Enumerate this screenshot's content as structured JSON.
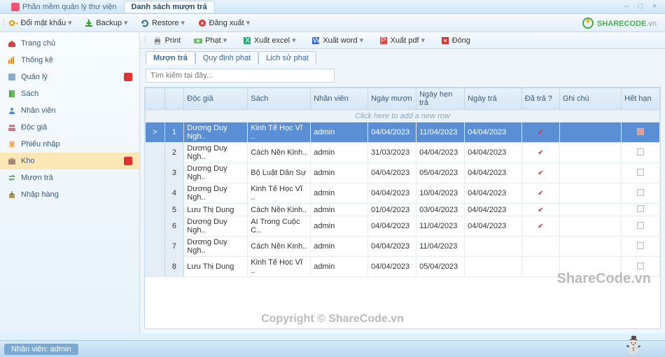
{
  "window": {
    "app_tab": "Phần mềm quản lý thư viện",
    "active_tab": "Danh sách mượn trả"
  },
  "toolbar1": {
    "change_pw": "Đổi mật khẩu",
    "backup": "Backup",
    "restore": "Restore",
    "logout": "Đăng xuất"
  },
  "sidebar": {
    "items": [
      {
        "label": "Trang chủ",
        "icon": "home",
        "badge": false
      },
      {
        "label": "Thống kê",
        "icon": "stats",
        "badge": false
      },
      {
        "label": "Quản lý",
        "icon": "manage",
        "badge": true
      },
      {
        "label": "Sách",
        "icon": "book",
        "badge": false
      },
      {
        "label": "Nhân viên",
        "icon": "user",
        "badge": false
      },
      {
        "label": "Độc giả",
        "icon": "users",
        "badge": false
      },
      {
        "label": "Phiếu nhập",
        "icon": "slip",
        "badge": false
      },
      {
        "label": "Kho",
        "icon": "store",
        "badge": true,
        "sel": true
      },
      {
        "label": "Mượn trả",
        "icon": "swap",
        "badge": false
      },
      {
        "label": "Nhập hàng",
        "icon": "import",
        "badge": false
      }
    ]
  },
  "toolbar2": {
    "print": "Print",
    "fine": "Phạt",
    "excel": "Xuất excel",
    "word": "Xuất word",
    "pdf": "Xuất pdf",
    "close": "Đóng"
  },
  "tabs2": {
    "t0": "Mượn trả",
    "t1": "Quy định phạt",
    "t2": "Lịch sử phạt"
  },
  "search": {
    "placeholder": "Tìm kiếm tại đây..."
  },
  "grid": {
    "cols": {
      "reader": "Độc giả",
      "book": "Sách",
      "staff": "Nhân viên",
      "borrow": "Ngày mượn",
      "due": "Ngày hẹn trả",
      "return": "Ngày trả",
      "returned": "Đã trả ?",
      "note": "Ghi chú",
      "expired": "Hết hạn"
    },
    "newrow": "Click here to add a new row",
    "rows": [
      {
        "n": "1",
        "reader": "Dương Duy Ngh..",
        "book": "Kinh Tế Học Vĩ ..",
        "staff": "admin",
        "borrow": "04/04/2023",
        "due": "11/04/2023",
        "return": "04/04/2023",
        "returned": true,
        "exp": true,
        "sel": true,
        "mark": ">"
      },
      {
        "n": "2",
        "reader": "Dương Duy Ngh..",
        "book": "Cách Nền Kinh..",
        "staff": "admin",
        "borrow": "31/03/2023",
        "due": "04/04/2023",
        "return": "04/04/2023",
        "returned": true,
        "exp": false
      },
      {
        "n": "3",
        "reader": "Dương Duy Ngh..",
        "book": "Bộ Luật Dân Sự",
        "staff": "admin",
        "borrow": "04/04/2023",
        "due": "05/04/2023",
        "return": "04/04/2023",
        "returned": true,
        "exp": false
      },
      {
        "n": "4",
        "reader": "Dương Duy Ngh..",
        "book": "Kinh Tế Học Vĩ ..",
        "staff": "admin",
        "borrow": "04/04/2023",
        "due": "10/04/2023",
        "return": "04/04/2023",
        "returned": true,
        "exp": false
      },
      {
        "n": "5",
        "reader": "Lưu Thị Dung",
        "book": "Cách Nền Kinh..",
        "staff": "admin",
        "borrow": "01/04/2023",
        "due": "03/04/2023",
        "return": "04/04/2023",
        "returned": true,
        "exp": false
      },
      {
        "n": "6",
        "reader": "Dương Duy Ngh..",
        "book": "AI Trong Cuộc C..",
        "staff": "admin",
        "borrow": "04/04/2023",
        "due": "11/04/2023",
        "return": "04/04/2023",
        "returned": true,
        "exp": false
      },
      {
        "n": "7",
        "reader": "Dương Duy Ngh..",
        "book": "Cách Nền Kinh..",
        "staff": "admin",
        "borrow": "04/04/2023",
        "due": "11/04/2023",
        "return": "",
        "returned": false,
        "exp": false
      },
      {
        "n": "8",
        "reader": "Lưu Thị Dung",
        "book": "Kinh Tế Học Vĩ ..",
        "staff": "admin",
        "borrow": "04/04/2023",
        "due": "05/04/2023",
        "return": "",
        "returned": false,
        "exp": false
      }
    ]
  },
  "status": {
    "user": "Nhân viên: admin"
  },
  "watermark": "ShareCode.vn",
  "copyright": "Copyright © ShareCode.vn",
  "logo": {
    "brand": "SHARECODE",
    "suffix": ".vn"
  }
}
